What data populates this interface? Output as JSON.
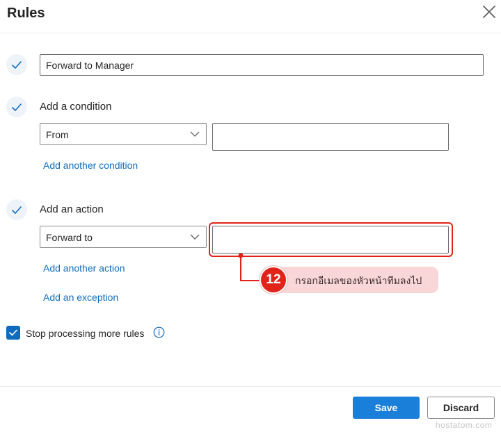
{
  "dialog": {
    "title": "Rules"
  },
  "rule_name": {
    "value": "Forward to Manager"
  },
  "condition": {
    "heading": "Add a condition",
    "select_value": "From",
    "value_input": "",
    "add_link": "Add another condition"
  },
  "action": {
    "heading": "Add an action",
    "select_value": "Forward to",
    "value_input": "",
    "add_link": "Add another action",
    "exception_link": "Add an exception"
  },
  "annotation": {
    "step_number": "12",
    "text": "กรอกอีเมลของหัวหน้าทีมลงไป",
    "color": "#e2231a"
  },
  "options": {
    "stop_processing_label": "Stop processing more rules",
    "stop_processing_checked": true
  },
  "footer": {
    "save_label": "Save",
    "discard_label": "Discard"
  },
  "watermark": "hostatom.com",
  "colors": {
    "accent": "#0f6cbd",
    "primary_button": "#1a7fd9"
  },
  "icons": {
    "step": "checkmark-icon",
    "close": "close-icon",
    "dropdown": "chevron-down-icon",
    "info": "info-icon"
  }
}
